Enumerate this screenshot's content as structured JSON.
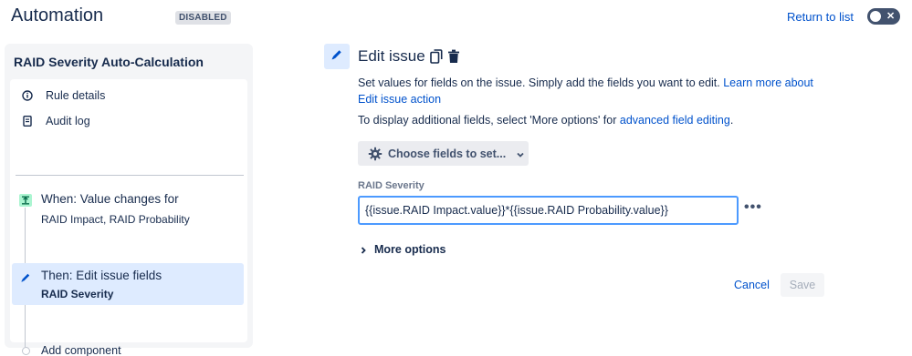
{
  "header": {
    "title": "Automation",
    "status": "DISABLED",
    "return_link": "Return to list",
    "toggle_state": "off"
  },
  "rule": {
    "name": "RAID Severity Auto-Calculation",
    "nav": [
      {
        "label": "Rule details",
        "icon": "info-icon"
      },
      {
        "label": "Audit log",
        "icon": "document-icon"
      }
    ],
    "trigger": {
      "title": "When: Value changes for",
      "detail": "RAID Impact, RAID Probability",
      "icon": "trigger-icon"
    },
    "action": {
      "title": "Then: Edit issue fields",
      "detail": "RAID Severity",
      "icon": "pencil-icon"
    },
    "add_component": "Add component"
  },
  "editor": {
    "title": "Edit issue",
    "description_text": "Set values for fields on the issue. Simply add the fields you want to edit. ",
    "description_link": "Learn more about Edit issue action",
    "advanced_text": "To display additional fields, select 'More options' for ",
    "advanced_link": "advanced field editing",
    "advanced_suffix": ".",
    "choose_fields_label": "Choose fields to set...",
    "field": {
      "label": "RAID Severity",
      "value": "{{issue.RAID Impact.value}}*{{issue.RAID Probability.value}}"
    },
    "more_dots": "•••",
    "more_options_label": "More options",
    "cancel_label": "Cancel",
    "save_label": "Save"
  },
  "colors": {
    "brand_link": "#0052cc",
    "selected_bg": "#deebff",
    "trigger_bg": "#abf5d1",
    "focus_border": "#4c9aff"
  }
}
